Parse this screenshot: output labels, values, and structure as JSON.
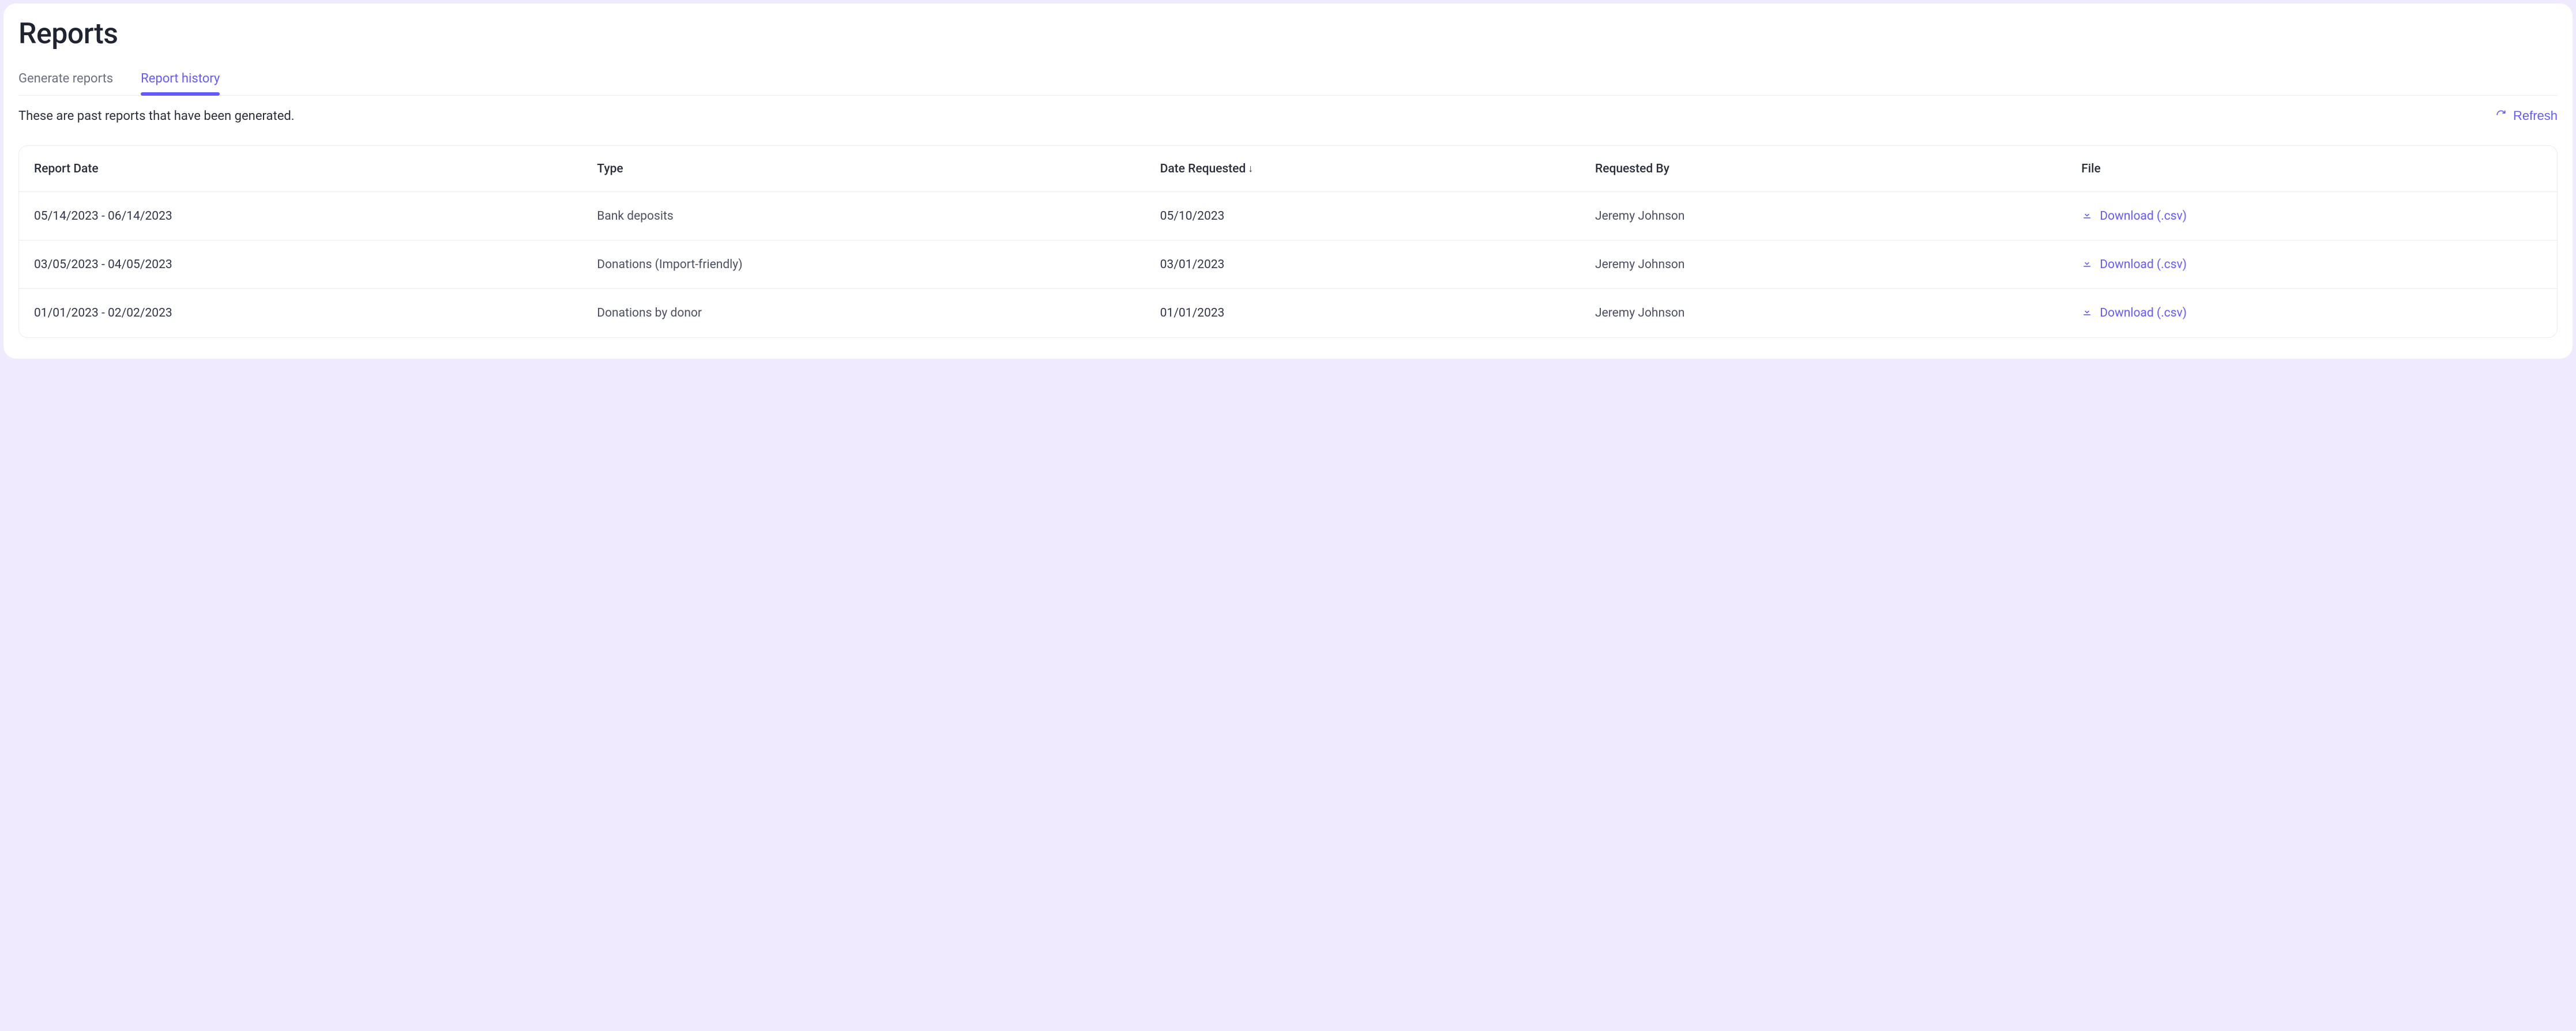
{
  "page": {
    "title": "Reports",
    "subheader": "These are past reports that have been generated."
  },
  "tabs": {
    "generate": {
      "label": "Generate reports"
    },
    "history": {
      "label": "Report history"
    }
  },
  "actions": {
    "refresh_label": "Refresh"
  },
  "table": {
    "columns": {
      "report_date": "Report Date",
      "type": "Type",
      "date_requested": "Date Requested",
      "requested_by": "Requested By",
      "file": "File"
    },
    "sort_indicator": "↓",
    "download_label": "Download (.csv)",
    "rows": [
      {
        "report_date": "05/14/2023 - 06/14/2023",
        "type": "Bank deposits",
        "date_requested": "05/10/2023",
        "requested_by": "Jeremy Johnson"
      },
      {
        "report_date": "03/05/2023 - 04/05/2023",
        "type": "Donations (Import-friendly)",
        "date_requested": "03/01/2023",
        "requested_by": "Jeremy Johnson"
      },
      {
        "report_date": "01/01/2023 - 02/02/2023",
        "type": "Donations by donor",
        "date_requested": "01/01/2023",
        "requested_by": "Jeremy Johnson"
      }
    ]
  }
}
